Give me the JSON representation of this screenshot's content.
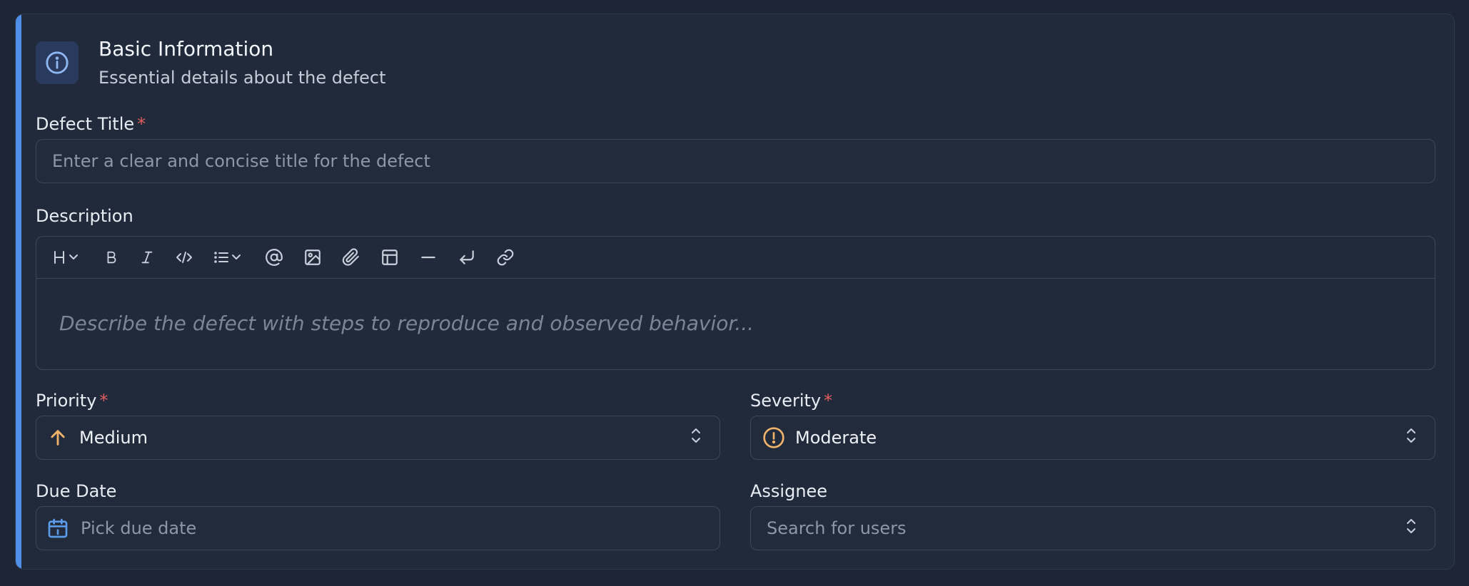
{
  "section": {
    "title": "Basic Information",
    "subtitle": "Essential details about the defect",
    "icon": "info-icon"
  },
  "fields": {
    "defect_title": {
      "label": "Defect Title",
      "required_mark": "*",
      "placeholder": "Enter a clear and concise title for the defect"
    },
    "description": {
      "label": "Description",
      "placeholder": "Describe the defect with steps to reproduce and observed behavior...",
      "toolbar": [
        "heading",
        "bold",
        "italic",
        "code",
        "list",
        "mention",
        "image",
        "attachment",
        "table",
        "horizontal-rule",
        "hard-break",
        "link"
      ]
    },
    "priority": {
      "label": "Priority",
      "required_mark": "*",
      "value": "Medium",
      "icon": "arrow-up-icon"
    },
    "severity": {
      "label": "Severity",
      "required_mark": "*",
      "value": "Moderate",
      "icon": "alert-circle-icon"
    },
    "due_date": {
      "label": "Due Date",
      "placeholder": "Pick due date",
      "icon": "calendar-icon"
    },
    "assignee": {
      "label": "Assignee",
      "placeholder": "Search for users"
    }
  },
  "colors": {
    "accent": "#4f8fe8",
    "required": "#e35d5d",
    "priority_icon": "#f0b36a",
    "severity_icon": "#f0b36a",
    "calendar_icon": "#5b9be8"
  }
}
